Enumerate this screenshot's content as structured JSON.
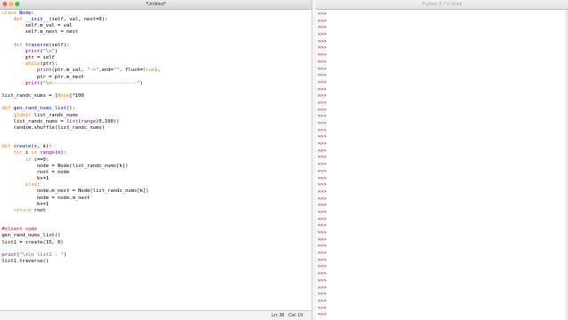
{
  "editor": {
    "title": "*Untitled*",
    "status": {
      "line": "Ln: 38",
      "col": "Col: 19"
    },
    "code_lines": [
      [
        {
          "t": "class ",
          "c": "kw"
        },
        {
          "t": "Node",
          "c": "fn"
        },
        {
          "t": ":",
          "c": ""
        }
      ],
      [
        {
          "t": "    ",
          "c": ""
        },
        {
          "t": "def ",
          "c": "kw"
        },
        {
          "t": "__init__",
          "c": "fn"
        },
        {
          "t": "(self, val, next=0):",
          "c": ""
        }
      ],
      [
        {
          "t": "        self.m_val = val",
          "c": ""
        }
      ],
      [
        {
          "t": "        self.m_next = next",
          "c": ""
        }
      ],
      [
        {
          "t": "",
          "c": ""
        }
      ],
      [
        {
          "t": "    ",
          "c": ""
        },
        {
          "t": "def ",
          "c": "kw"
        },
        {
          "t": "traverse",
          "c": "fn"
        },
        {
          "t": "(self):",
          "c": ""
        }
      ],
      [
        {
          "t": "        ",
          "c": ""
        },
        {
          "t": "print",
          "c": "bi"
        },
        {
          "t": "(",
          "c": ""
        },
        {
          "t": "\"\\n\"",
          "c": "st"
        },
        {
          "t": ")",
          "c": ""
        }
      ],
      [
        {
          "t": "        ptr = self",
          "c": ""
        }
      ],
      [
        {
          "t": "        ",
          "c": ""
        },
        {
          "t": "while",
          "c": "kw"
        },
        {
          "t": "(ptr):",
          "c": ""
        }
      ],
      [
        {
          "t": "            ",
          "c": ""
        },
        {
          "t": "print",
          "c": "bi"
        },
        {
          "t": "(ptr.m_val, ",
          "c": ""
        },
        {
          "t": "\"->\"",
          "c": "st"
        },
        {
          "t": ",end=",
          "c": ""
        },
        {
          "t": "\"\"",
          "c": "st"
        },
        {
          "t": ", flush=",
          "c": ""
        },
        {
          "t": "True",
          "c": "kw"
        },
        {
          "t": "),",
          "c": ""
        }
      ],
      [
        {
          "t": "            ptr = ptr.m_next",
          "c": ""
        }
      ],
      [
        {
          "t": "        ",
          "c": ""
        },
        {
          "t": "print",
          "c": "bi"
        },
        {
          "t": "(",
          "c": ""
        },
        {
          "t": "\"\\n-----------------------------\"",
          "c": "st"
        },
        {
          "t": ")",
          "c": ""
        }
      ],
      [
        {
          "t": "",
          "c": ""
        }
      ],
      [
        {
          "t": "list_randc_nums = [",
          "c": ""
        },
        {
          "t": "None",
          "c": "kw"
        },
        {
          "t": "]*100",
          "c": ""
        }
      ],
      [
        {
          "t": "",
          "c": ""
        }
      ],
      [
        {
          "t": "def ",
          "c": "kw"
        },
        {
          "t": "gen_rand_nums_list",
          "c": "fn"
        },
        {
          "t": "():",
          "c": ""
        }
      ],
      [
        {
          "t": "    ",
          "c": ""
        },
        {
          "t": "global",
          "c": "kw"
        },
        {
          "t": " list_randc_nums",
          "c": ""
        }
      ],
      [
        {
          "t": "    list_randc_nums = ",
          "c": ""
        },
        {
          "t": "list",
          "c": "bi"
        },
        {
          "t": "(",
          "c": ""
        },
        {
          "t": "range",
          "c": "bi"
        },
        {
          "t": "(0,100))",
          "c": ""
        }
      ],
      [
        {
          "t": "    random.shuffle(list_randc_nums)",
          "c": ""
        }
      ],
      [
        {
          "t": "",
          "c": ""
        }
      ],
      [
        {
          "t": "",
          "c": ""
        }
      ],
      [
        {
          "t": "def ",
          "c": "kw"
        },
        {
          "t": "create",
          "c": "fn"
        },
        {
          "t": "(n, k):",
          "c": ""
        }
      ],
      [
        {
          "t": "    ",
          "c": ""
        },
        {
          "t": "for",
          "c": "kw"
        },
        {
          "t": " i ",
          "c": ""
        },
        {
          "t": "in",
          "c": "kw"
        },
        {
          "t": " ",
          "c": ""
        },
        {
          "t": "range",
          "c": "bi"
        },
        {
          "t": "(n):",
          "c": ""
        }
      ],
      [
        {
          "t": "        ",
          "c": ""
        },
        {
          "t": "if",
          "c": "kw"
        },
        {
          "t": " i==0:",
          "c": ""
        }
      ],
      [
        {
          "t": "            node = Node(list_randc_nums[k])",
          "c": ""
        }
      ],
      [
        {
          "t": "            root = node",
          "c": ""
        }
      ],
      [
        {
          "t": "            k+=1",
          "c": ""
        }
      ],
      [
        {
          "t": "        ",
          "c": ""
        },
        {
          "t": "else",
          "c": "kw"
        },
        {
          "t": ":",
          "c": ""
        }
      ],
      [
        {
          "t": "            node.m_next = Node(list_randc_nums[k])",
          "c": ""
        }
      ],
      [
        {
          "t": "            node = node.m_next",
          "c": ""
        }
      ],
      [
        {
          "t": "            k+=1",
          "c": ""
        }
      ],
      [
        {
          "t": "    ",
          "c": ""
        },
        {
          "t": "return",
          "c": "kw"
        },
        {
          "t": " root",
          "c": ""
        }
      ],
      [
        {
          "t": "",
          "c": ""
        }
      ],
      [
        {
          "t": "",
          "c": ""
        }
      ],
      [
        {
          "t": "#client code",
          "c": "cm"
        }
      ],
      [
        {
          "t": "gen_rand_nums_list()",
          "c": ""
        }
      ],
      [
        {
          "t": "list1 = create(15, 0)",
          "c": ""
        }
      ],
      [
        {
          "t": "",
          "c": ""
        }
      ],
      [
        {
          "t": "print",
          "c": "bi"
        },
        {
          "t": "(",
          "c": ""
        },
        {
          "t": "\"\\n\\n list1 : \"",
          "c": "st"
        },
        {
          "t": ")",
          "c": ""
        }
      ],
      [
        {
          "t": "list1.traverse()",
          "c": ""
        }
      ]
    ]
  },
  "shell": {
    "title": "Python 3.7.0 Shell",
    "prompt": ">>>",
    "prompt_count": 45
  },
  "colors": {
    "close": "#fc5f57",
    "minimize": "#fdbc2e",
    "zoom": "#33c748",
    "keyword": "#ff7700",
    "definition": "#0000ff",
    "string": "#00aa00",
    "builtin": "#900090",
    "comment": "#dd0000",
    "prompt": "#800000"
  }
}
